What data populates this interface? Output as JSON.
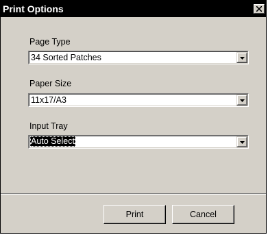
{
  "window": {
    "title": "Print Options"
  },
  "fields": {
    "page_type": {
      "label": "Page Type",
      "value": "34 Sorted Patches"
    },
    "paper_size": {
      "label": "Paper Size",
      "value": "11x17/A3"
    },
    "input_tray": {
      "label": "Input Tray",
      "value": "Auto Select",
      "focused": true
    }
  },
  "buttons": {
    "print_label": "Print",
    "cancel_label": "Cancel"
  },
  "colors": {
    "face": "#d4d0c8",
    "titlebar": "#000000",
    "selection": "#000000"
  },
  "icons": {
    "close": "close-x-icon",
    "dropdown": "triangle-down-icon"
  }
}
